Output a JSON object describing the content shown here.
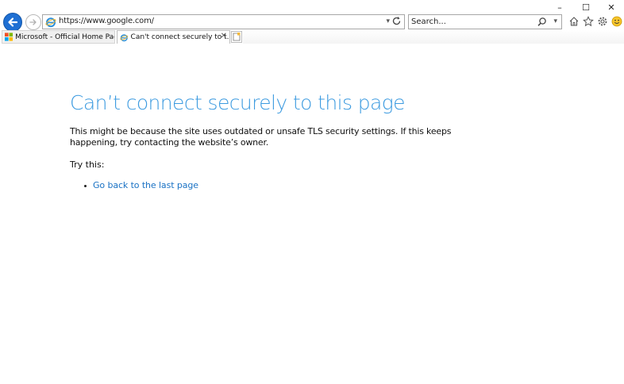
{
  "window": {
    "minimize_glyph": "–",
    "maximize_glyph": "☐",
    "close_glyph": "✕"
  },
  "addressbar": {
    "url": "https://www.google.com/",
    "dropdown_glyph": "▾"
  },
  "search": {
    "placeholder": "Search...",
    "dropdown_glyph": "▾"
  },
  "tabs": [
    {
      "label": "Microsoft - Official Home Page",
      "icon": "windows-logo-icon"
    },
    {
      "label": "Can't connect securely to t...",
      "icon": "ie-icon",
      "close": "✕"
    }
  ],
  "page": {
    "title": "Can’t connect securely to this page",
    "description": "This might be because the site uses outdated or unsafe TLS security settings. If this keeps happening, try contacting the website’s owner.",
    "try_this": "Try this:",
    "suggestions": [
      {
        "label": "Go back to the last page"
      }
    ]
  },
  "colors": {
    "title": "#3d9be0",
    "link": "#1a72c4",
    "back_button": "#1e6fd3"
  }
}
